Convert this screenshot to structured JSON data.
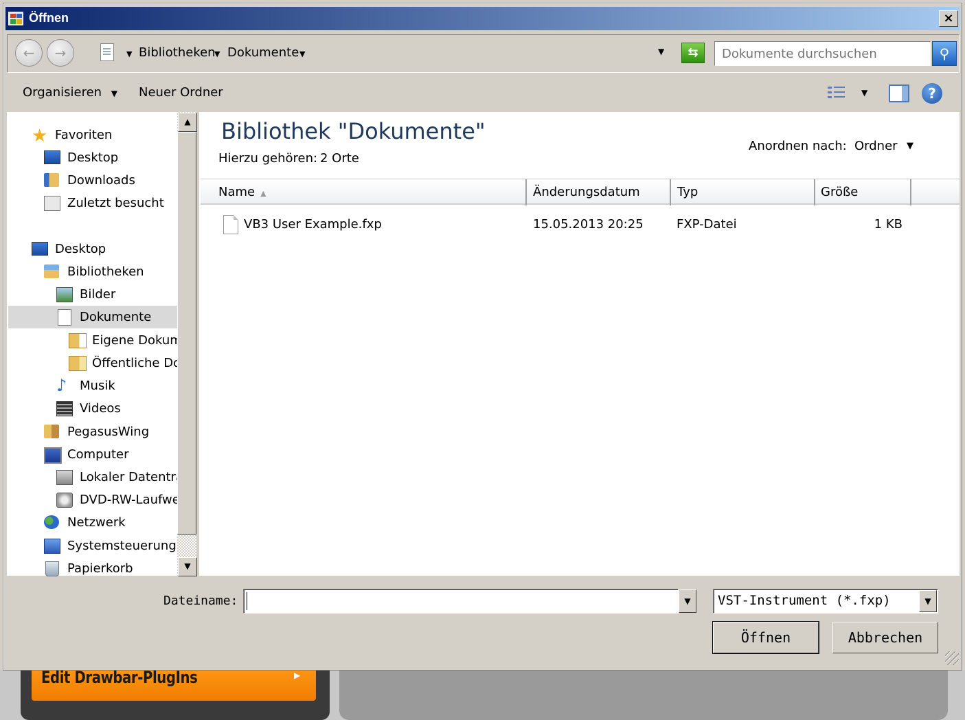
{
  "background_app": {
    "button_label": "Edit Drawbar-PlugIns",
    "orange": "#f5890a"
  },
  "window": {
    "title": "Öffnen",
    "close_label": "×"
  },
  "address_bar": {
    "crumbs": [
      "Bibliotheken",
      "Dokumente"
    ],
    "search_placeholder": "Dokumente durchsuchen"
  },
  "toolbar": {
    "organize_label": "Organisieren",
    "new_folder_label": "Neuer Ordner"
  },
  "nav": {
    "items": [
      {
        "label": "Favoriten",
        "icon": "star-icon"
      },
      {
        "label": "Desktop",
        "icon": "desktop-icon"
      },
      {
        "label": "Downloads",
        "icon": "downloads-folder-icon"
      },
      {
        "label": "Zuletzt besucht",
        "icon": "recent-places-icon"
      },
      {
        "label": "Desktop",
        "icon": "desktop-icon"
      },
      {
        "label": "Bibliotheken",
        "icon": "libraries-icon"
      },
      {
        "label": "Bilder",
        "icon": "pictures-icon"
      },
      {
        "label": "Dokumente",
        "icon": "documents-icon",
        "selected": true
      },
      {
        "label": "Eigene Dokume",
        "icon": "folder-icon"
      },
      {
        "label": "Öffentliche Dol",
        "icon": "folder-icon"
      },
      {
        "label": "Musik",
        "icon": "music-icon"
      },
      {
        "label": "Videos",
        "icon": "videos-icon"
      },
      {
        "label": "PegasusWing",
        "icon": "user-folder-icon"
      },
      {
        "label": "Computer",
        "icon": "computer-icon"
      },
      {
        "label": "Lokaler Datenträ",
        "icon": "local-disk-icon"
      },
      {
        "label": "DVD-RW-Laufwe",
        "icon": "dvd-drive-icon"
      },
      {
        "label": "Netzwerk",
        "icon": "network-icon"
      },
      {
        "label": "Systemsteuerung",
        "icon": "control-panel-icon"
      },
      {
        "label": "Papierkorb",
        "icon": "recycle-bin-icon"
      }
    ]
  },
  "content": {
    "title": "Bibliothek \"Dokumente\"",
    "includes_label": "Hierzu gehören:",
    "includes_link": "2 Orte",
    "arrange_label": "Anordnen nach:",
    "arrange_value": "Ordner",
    "columns": [
      "Name",
      "Änderungsdatum",
      "Typ",
      "Größe"
    ],
    "files": [
      {
        "name": "VB3 User Example.fxp",
        "modified": "15.05.2013 20:25",
        "type": "FXP-Datei",
        "size": "1 KB"
      }
    ]
  },
  "footer": {
    "filename_label": "Dateiname:",
    "filename_value": "",
    "filter_value": "VST-Instrument (*.fxp)",
    "open_label": "Öffnen",
    "cancel_label": "Abbrechen"
  }
}
